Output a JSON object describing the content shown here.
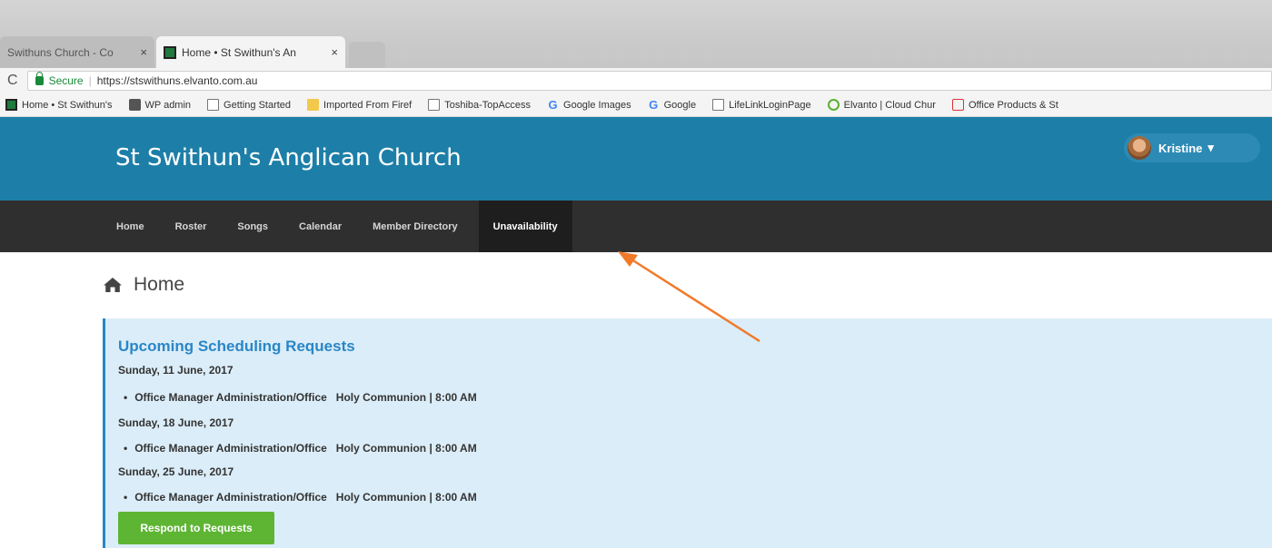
{
  "browser": {
    "tabs": [
      {
        "title": "Swithuns Church - Co",
        "close": "×"
      },
      {
        "title": "Home • St Swithun's An",
        "close": "×"
      }
    ],
    "reload_glyph": "C",
    "secure_label": "Secure",
    "url": "https://stswithuns.elvanto.com.au",
    "bookmarks": [
      {
        "label": "Home • St Swithun's",
        "icon": "elvanto-favicon"
      },
      {
        "label": "WP admin",
        "icon": "wordpress-icon"
      },
      {
        "label": "Getting Started",
        "icon": "page-icon"
      },
      {
        "label": "Imported From Firef",
        "icon": "folder-icon"
      },
      {
        "label": "Toshiba-TopAccess",
        "icon": "page-icon"
      },
      {
        "label": "Google Images",
        "icon": "google-icon"
      },
      {
        "label": "Google",
        "icon": "google-icon"
      },
      {
        "label": "LifeLinkLoginPage",
        "icon": "page-icon"
      },
      {
        "label": "Elvanto | Cloud Chur",
        "icon": "elvanto-check-icon"
      },
      {
        "label": "Office Products & St",
        "icon": "office-icon"
      }
    ]
  },
  "header": {
    "site_title": "St Swithun's Anglican Church",
    "user_name": "Kristine",
    "caret": "▾"
  },
  "nav": {
    "items": [
      "Home",
      "Roster",
      "Songs",
      "Calendar",
      "Member Directory",
      "Unavailability"
    ],
    "active_index": 5
  },
  "page": {
    "heading": "Home"
  },
  "requests": {
    "title": "Upcoming Scheduling Requests",
    "groups": [
      {
        "date": "Sunday, 11 June, 2017",
        "role": "Office Manager Administration/Office",
        "service": "Holy Communion | 8:00 AM"
      },
      {
        "date": "Sunday, 18 June, 2017",
        "role": "Office Manager Administration/Office",
        "service": "Holy Communion | 8:00 AM"
      },
      {
        "date": "Sunday, 25 June, 2017",
        "role": "Office Manager Administration/Office",
        "service": "Holy Communion | 8:00 AM"
      }
    ],
    "bullet": "•",
    "button_label": "Respond to Requests"
  },
  "colors": {
    "header_bg": "#1d7fa8",
    "nav_bg": "#2f2f2f",
    "panel_bg": "#dbedf8",
    "panel_accent": "#2a86c6",
    "button_green": "#5eb534",
    "annotation_arrow": "#f07a2a"
  }
}
